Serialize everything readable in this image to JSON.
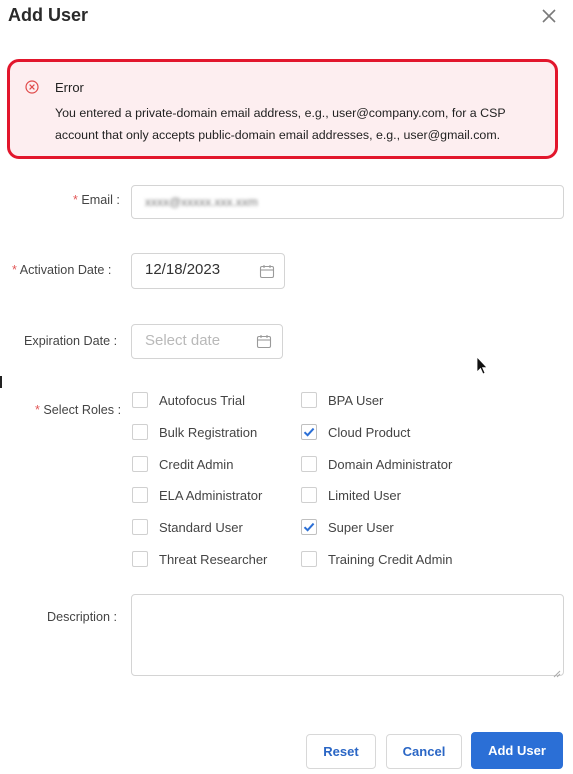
{
  "dialog": {
    "title": "Add User",
    "close_icon": "close-icon"
  },
  "error": {
    "title": "Error",
    "message": "You entered a private-domain email address, e.g., user@company.com, for a CSP account that only accepts public-domain email addresses, e.g., user@gmail.com.",
    "icon": "error-circle-icon",
    "border_color": "#e2162c",
    "background": "#fdeef0"
  },
  "form": {
    "email": {
      "label": "Email :",
      "required_mark": "*",
      "value": "xxxx@xxxxx.xxx.xxm"
    },
    "activation_date": {
      "label": "Activation Date :",
      "required_mark": "*",
      "value": "12/18/2023"
    },
    "expiration_date": {
      "label": "Expiration Date :",
      "placeholder": "Select date"
    },
    "roles": {
      "label": "Select Roles :",
      "required_mark": "*",
      "items": [
        {
          "label": "Autofocus Trial",
          "checked": false
        },
        {
          "label": "BPA User",
          "checked": false
        },
        {
          "label": "Bulk Registration",
          "checked": false
        },
        {
          "label": "Cloud Product",
          "checked": true
        },
        {
          "label": "Credit Admin",
          "checked": false
        },
        {
          "label": "Domain Administrator",
          "checked": false
        },
        {
          "label": "ELA Administrator",
          "checked": false
        },
        {
          "label": "Limited User",
          "checked": false
        },
        {
          "label": "Standard User",
          "checked": false
        },
        {
          "label": "Super User",
          "checked": true
        },
        {
          "label": "Threat Researcher",
          "checked": false
        },
        {
          "label": "Training Credit Admin",
          "checked": false
        }
      ]
    },
    "description": {
      "label": "Description :",
      "value": ""
    }
  },
  "buttons": {
    "reset": "Reset",
    "cancel": "Cancel",
    "add_user": "Add User"
  },
  "colors": {
    "accent": "#2b6fd6",
    "required": "#e25555"
  }
}
